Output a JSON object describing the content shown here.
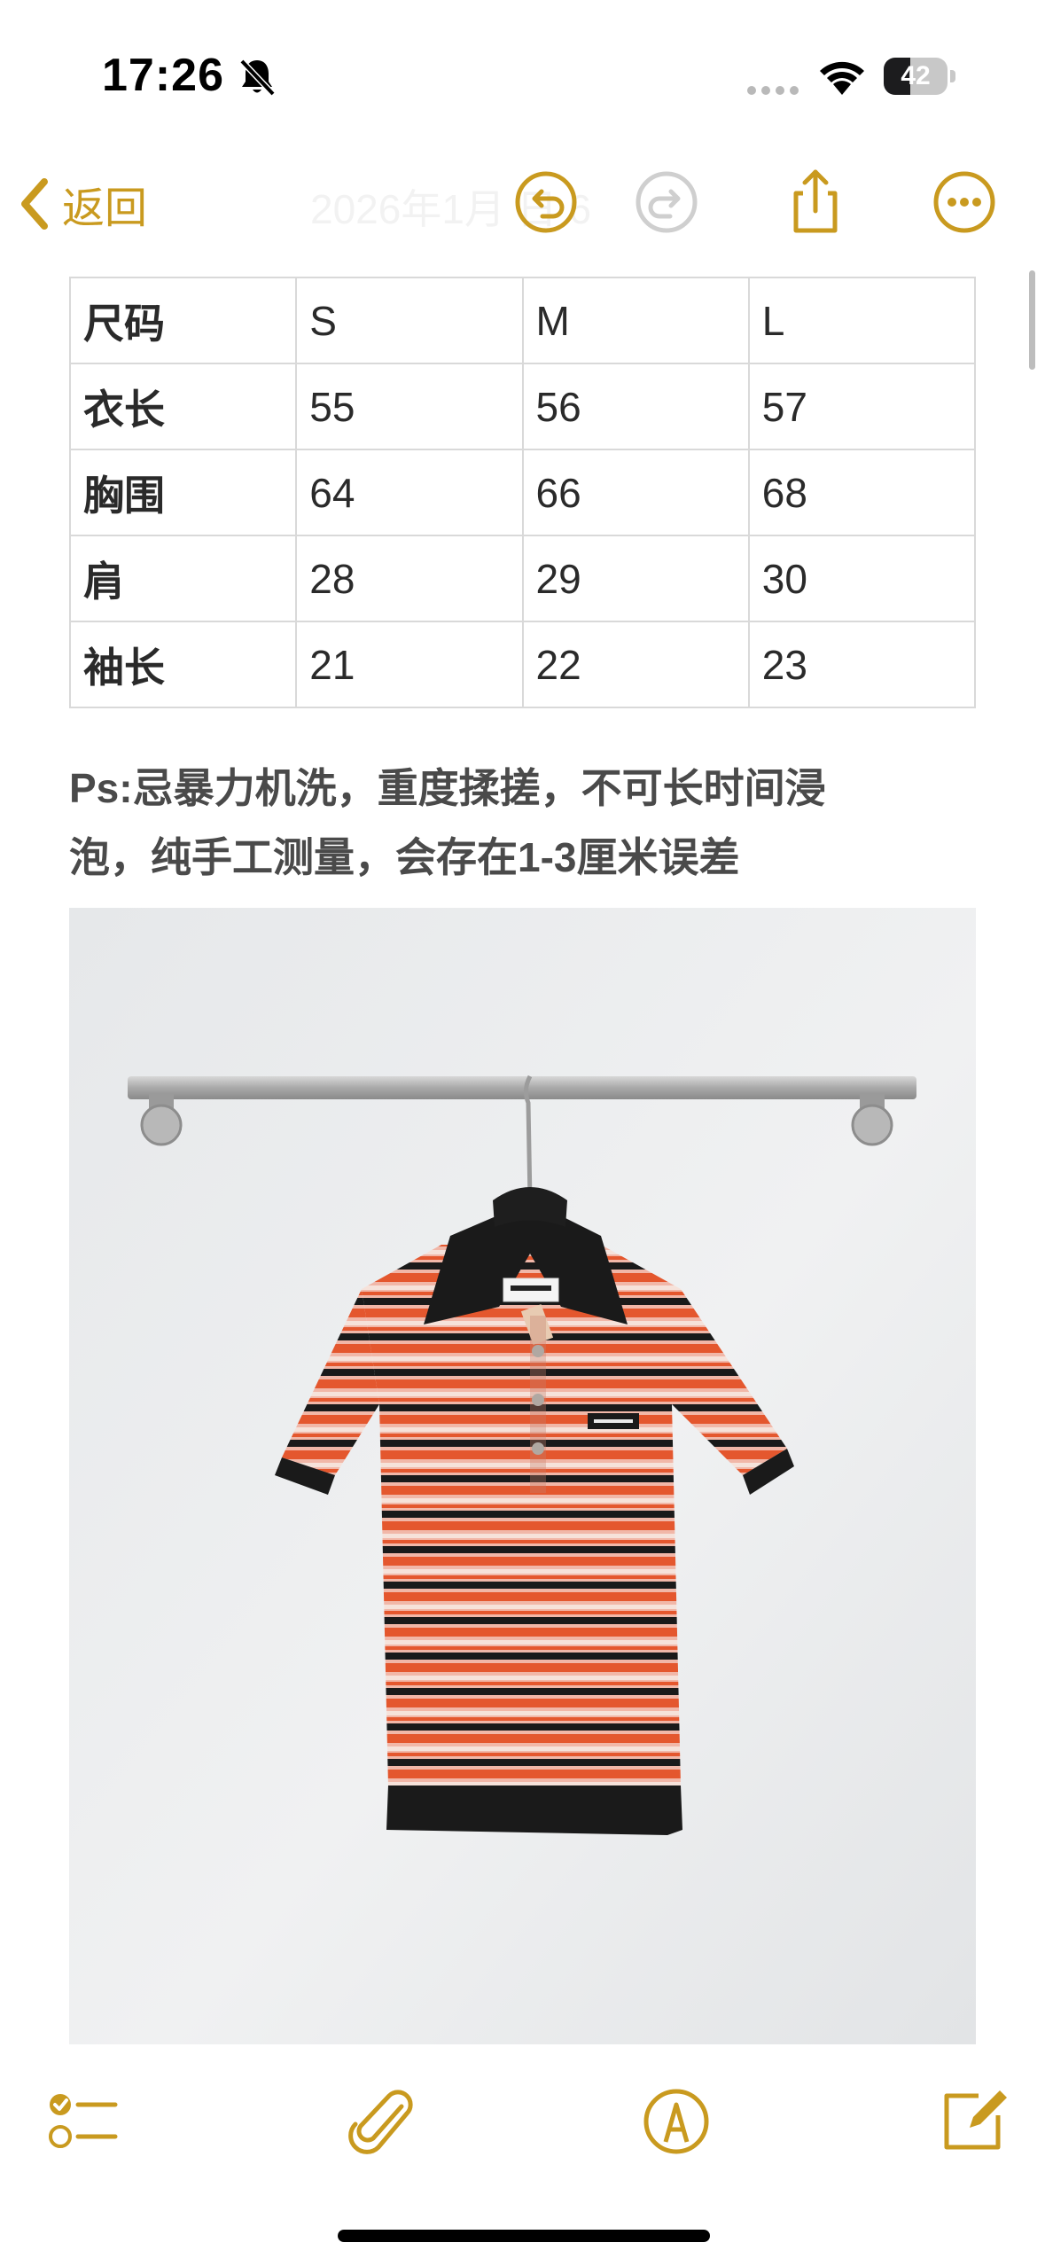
{
  "status_bar": {
    "time": "17:26",
    "battery_level": "42",
    "battery_fraction": 0.42,
    "icons": [
      "bell-slash-icon",
      "signal-dots-icon",
      "wifi-icon",
      "battery-icon"
    ]
  },
  "nav": {
    "back_label": "返回",
    "title": "2026年1月 日 6",
    "buttons": [
      "undo-icon",
      "redo-icon",
      "share-icon",
      "more-icon"
    ]
  },
  "size_table": {
    "header": [
      "尺码",
      "S",
      "M",
      "L"
    ],
    "rows": [
      [
        "衣长",
        "55",
        "56",
        "57"
      ],
      [
        "胸围",
        "64",
        "66",
        "68"
      ],
      [
        "肩",
        "28",
        "29",
        "30"
      ],
      [
        "袖长",
        "21",
        "22",
        "23"
      ]
    ]
  },
  "note": {
    "line1": "Ps:忌暴力机洗，重度揉搓，不可长时间浸",
    "line2": "泡，纯手工测量，会存在1-3厘米误差"
  },
  "photo": {
    "subject": "striped-polo-shirt-on-rack"
  },
  "toolbar": {
    "buttons": [
      "checklist-icon",
      "paperclip-icon",
      "markup-pen-icon",
      "compose-icon"
    ]
  },
  "colors": {
    "accent": "#c99a1f",
    "stripe_orange": "#e4572e",
    "stripe_pink": "#f1b7a8",
    "stripe_black": "#1a1a1a"
  }
}
